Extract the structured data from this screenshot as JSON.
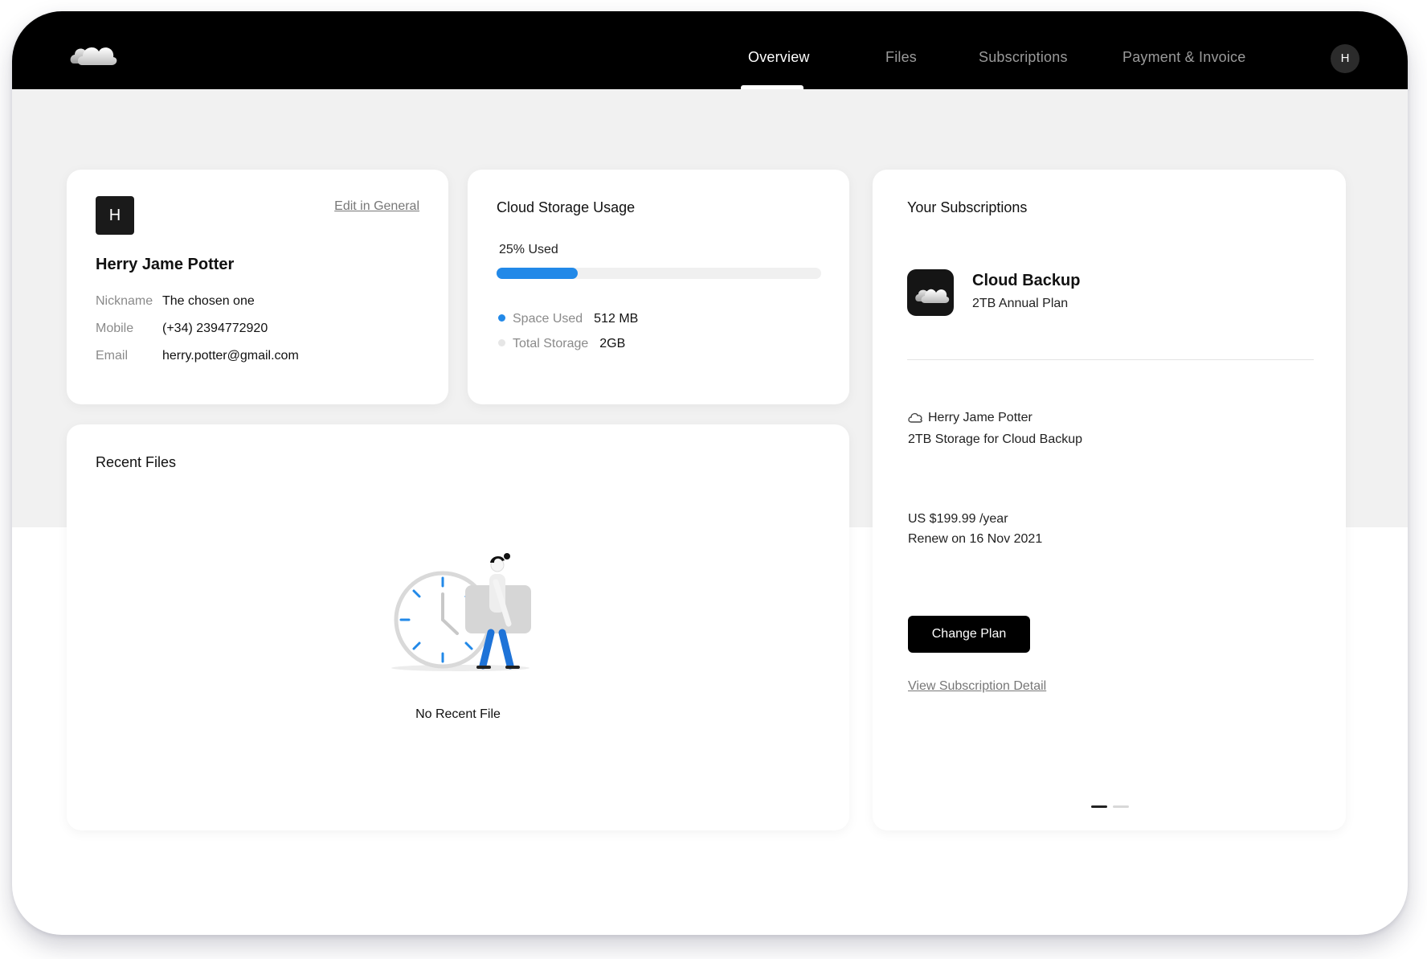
{
  "nav": {
    "tabs": [
      {
        "label": "Overview",
        "active": true
      },
      {
        "label": "Files",
        "active": false
      },
      {
        "label": "Subscriptions",
        "active": false
      },
      {
        "label": "Payment & Invoice",
        "active": false
      }
    ],
    "avatar_initial": "H",
    "logo_icon": "cloud-logo-icon"
  },
  "profile": {
    "avatar_initial": "H",
    "edit_label": "Edit in General",
    "name": "Herry Jame Potter",
    "fields": [
      {
        "label": "Nickname",
        "value": "The chosen one"
      },
      {
        "label": "Mobile",
        "value": "(+34) 2394772920"
      },
      {
        "label": "Email",
        "value": "herry.potter@gmail.com"
      }
    ]
  },
  "storage": {
    "title": "Cloud Storage Usage",
    "used_label": "25% Used",
    "used_fraction": 0.25,
    "legend": [
      {
        "label": "Space Used",
        "value": "512 MB",
        "color": "#2289e8"
      },
      {
        "label": "Total Storage",
        "value": "2GB",
        "color": "#e6e6e6"
      }
    ]
  },
  "recent": {
    "title": "Recent Files",
    "empty_text": "No Recent File"
  },
  "subscriptions": {
    "title": "Your Subscriptions",
    "app_name": "Cloud Backup",
    "plan": "2TB Annual Plan",
    "owner": "Herry Jame Potter",
    "storage_desc": "2TB Storage for Cloud Backup",
    "price": "US $199.99 /year",
    "renew": "Renew on 16 Nov 2021",
    "change_button": "Change Plan",
    "detail_link": "View Subscription Detail",
    "page_index": 1,
    "page_count": 2
  },
  "colors": {
    "accent": "#2289e8",
    "topbar": "#000000",
    "background": "#f1f1f1"
  }
}
